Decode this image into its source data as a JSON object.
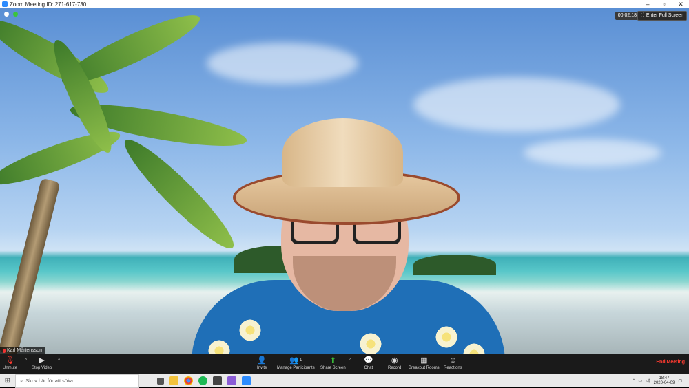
{
  "window": {
    "title": "Zoom Meeting ID: 271-617-730"
  },
  "meeting": {
    "timer": "00:02:18",
    "fullscreen_label": "Enter Full Screen",
    "participant_name": "Karl Mårtensson"
  },
  "toolbar": {
    "unmute": "Unmute",
    "stop_video": "Stop Video",
    "invite": "Invite",
    "manage_participants": "Manage Participants",
    "participant_count": "1",
    "share_screen": "Share Screen",
    "chat": "Chat",
    "record": "Record",
    "breakout_rooms": "Breakout Rooms",
    "reactions": "Reactions",
    "end_meeting": "End Meeting"
  },
  "taskbar": {
    "search_placeholder": "Skriv här för att söka",
    "time": "18:47",
    "date": "2020-04-09",
    "apps": [
      "task-view",
      "file-explorer",
      "chrome",
      "spotify",
      "notes",
      "visual-studio",
      "zoom"
    ]
  },
  "colors": {
    "accent": "#2d8cff",
    "end": "#ff3b30",
    "share": "#3bc43b"
  }
}
